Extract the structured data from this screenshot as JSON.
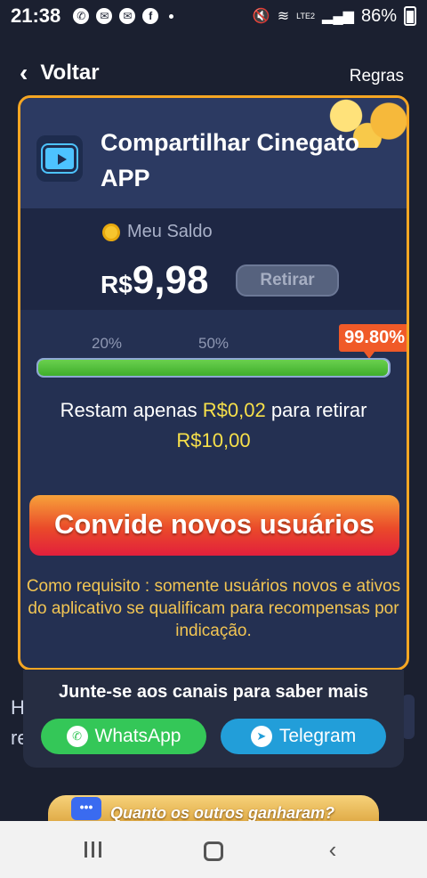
{
  "status_bar": {
    "time": "21:38",
    "battery": "86%",
    "network": "LTE2"
  },
  "header": {
    "back_label": "Voltar",
    "rules_label": "Regras"
  },
  "card": {
    "title": "Compartilhar Cinegato APP",
    "balance_label": "Meu Saldo",
    "currency": "R$",
    "balance_value": "9,98",
    "withdraw_label": "Retirar",
    "progress": {
      "percent_label": "99.80%",
      "value_percent": 99.8,
      "tick_20": "20%",
      "tick_50": "50%"
    },
    "remaining": {
      "prefix": "Restam apenas ",
      "amount": "R$0,02",
      "middle": " para retirar",
      "target": "R$10,00"
    },
    "invite_label": "Convide novos usuários",
    "note": "Como requisito : somente usuários novos e ativos do aplicativo se qualificam para recompensas por indicação."
  },
  "popup": {
    "title": "Junte-se aos canais para saber mais",
    "whatsapp_label": "WhatsApp",
    "telegram_label": "Telegram"
  },
  "banner": {
    "text": "Quanto os outros ganharam?"
  },
  "peek": {
    "line1": "H",
    "line2": "re"
  }
}
